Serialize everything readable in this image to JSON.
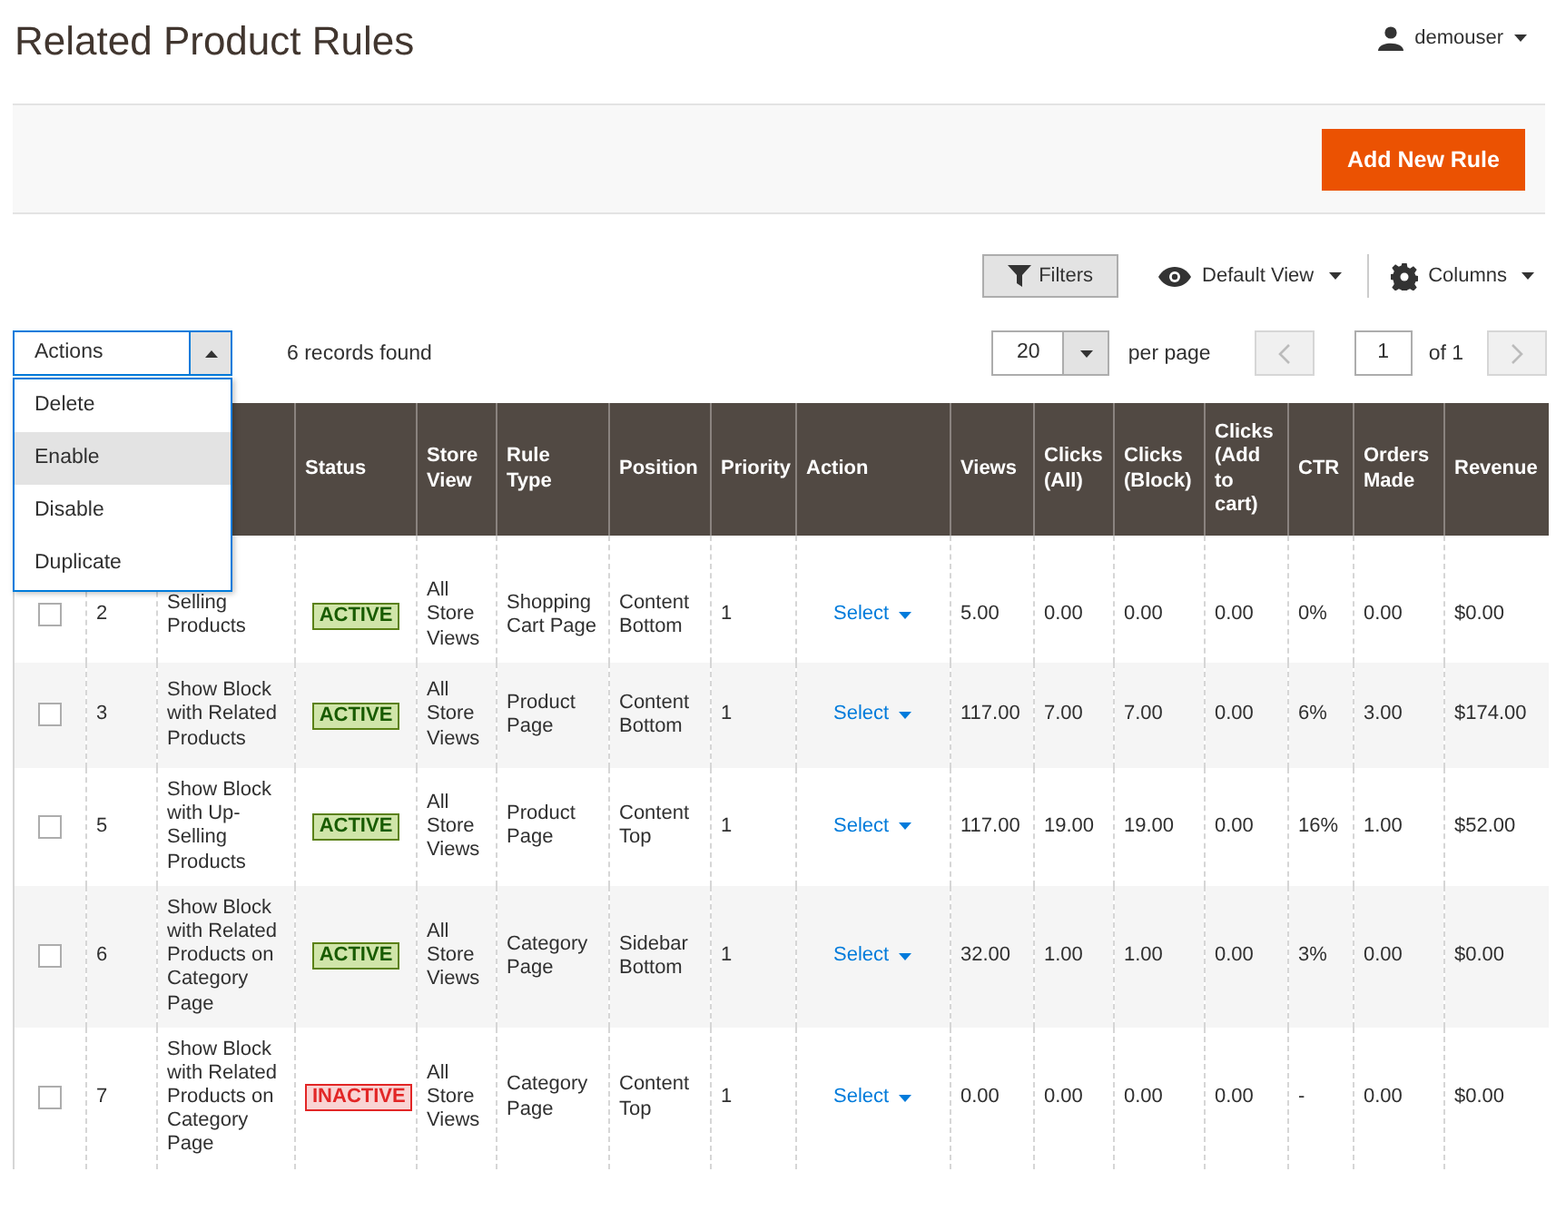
{
  "page": {
    "title": "Related Product Rules",
    "user": "demouser"
  },
  "header_bar": {
    "add_button": "Add New Rule"
  },
  "toolbar": {
    "filters": "Filters",
    "view": "Default View",
    "columns": "Columns"
  },
  "actions": {
    "label": "Actions",
    "expanded": true,
    "options": [
      {
        "label": "Delete",
        "selected": false
      },
      {
        "label": "Enable",
        "selected": true
      },
      {
        "label": "Disable",
        "selected": false
      },
      {
        "label": "Duplicate",
        "selected": false
      }
    ]
  },
  "records": "6 records found",
  "pager": {
    "per_page_value": "20",
    "per_page_label": "per page",
    "page_value": "1",
    "of": "of 1"
  },
  "table": {
    "columns": [
      "Status",
      "Store View",
      "Rule Type",
      "Position",
      "Priority",
      "Action",
      "Views",
      "Clicks (All)",
      "Clicks (Block)",
      "Clicks (Add to cart)",
      "CTR",
      "Orders Made",
      "Revenue"
    ],
    "rows": [
      {
        "checked": false,
        "id": "2",
        "name": "Selling Products",
        "status": "ACTIVE",
        "active": true,
        "store": "All Store Views",
        "rule_type": "Shopping Cart Page",
        "position": "Content Bottom",
        "priority": "1",
        "action": "Select",
        "stats": [
          "5.00",
          "0.00",
          "0.00",
          "0.00",
          "0%",
          "0.00",
          "$0.00"
        ]
      },
      {
        "checked": false,
        "id": "3",
        "name": "Show Block with Related Products",
        "status": "ACTIVE",
        "active": true,
        "store": "All Store Views",
        "rule_type": "Product Page",
        "position": "Content Bottom",
        "priority": "1",
        "action": "Select",
        "stats": [
          "117.00",
          "7.00",
          "7.00",
          "0.00",
          "6%",
          "3.00",
          "$174.00"
        ]
      },
      {
        "checked": false,
        "id": "5",
        "name": "Show Block with Up-Selling Products",
        "status": "ACTIVE",
        "active": true,
        "store": "All Store Views",
        "rule_type": "Product Page",
        "position": "Content Top",
        "priority": "1",
        "action": "Select",
        "stats": [
          "117.00",
          "19.00",
          "19.00",
          "0.00",
          "16%",
          "1.00",
          "$52.00"
        ]
      },
      {
        "checked": false,
        "id": "6",
        "name": "Show Block with Related Products on Category Page",
        "status": "ACTIVE",
        "active": true,
        "store": "All Store Views",
        "rule_type": "Category Page",
        "position": "Sidebar Bottom",
        "priority": "1",
        "action": "Select",
        "stats": [
          "32.00",
          "1.00",
          "1.00",
          "0.00",
          "3%",
          "0.00",
          "$0.00"
        ]
      },
      {
        "checked": false,
        "id": "7",
        "name": "Show Block with Related Products on Category Page",
        "status": "INACTIVE",
        "active": false,
        "store": "All Store Views",
        "rule_type": "Category Page",
        "position": "Content Top",
        "priority": "1",
        "action": "Select",
        "stats": [
          "0.00",
          "0.00",
          "0.00",
          "0.00",
          "-",
          "0.00",
          "$0.00"
        ]
      }
    ]
  }
}
